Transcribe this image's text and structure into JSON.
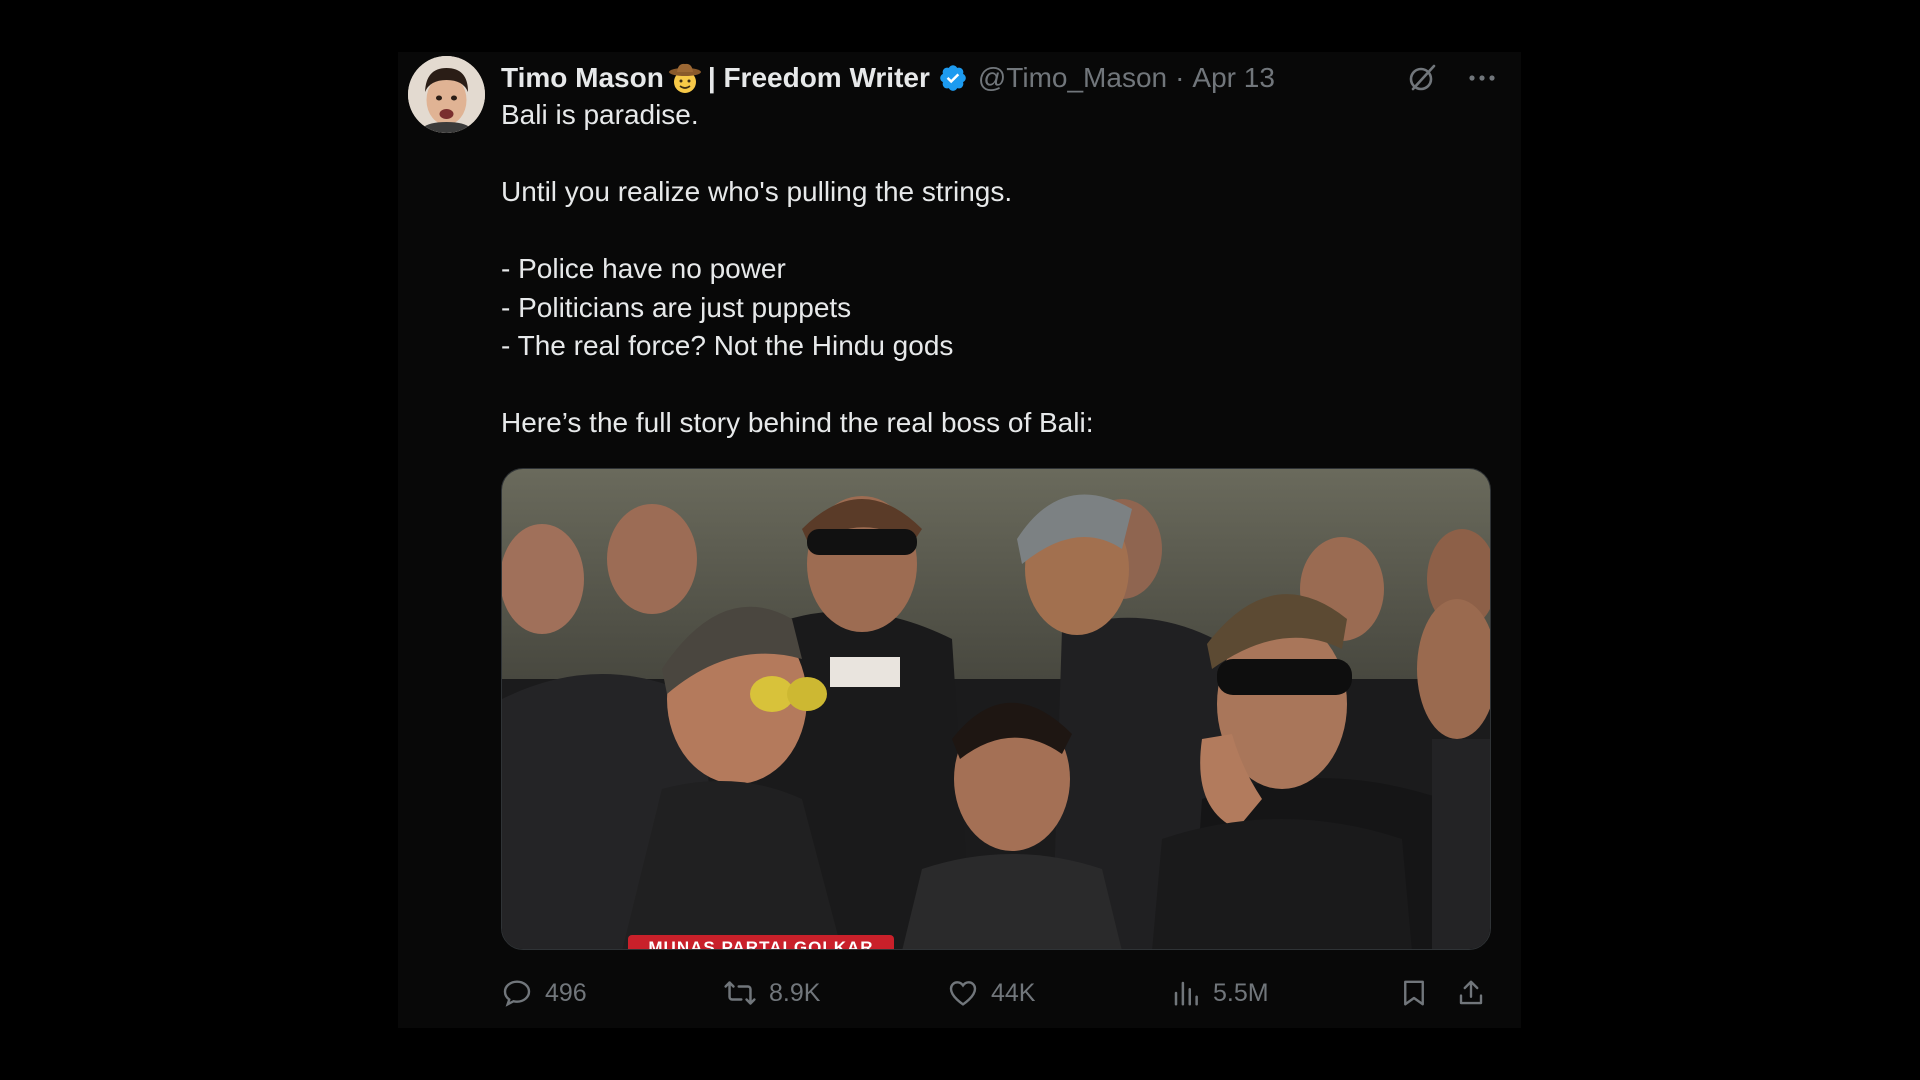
{
  "tweet": {
    "author": {
      "display_name": "Timo Mason",
      "name_emoji": "cowboy-face-emoji",
      "display_suffix": "| Freedom Writer",
      "verified": true,
      "handle": "@Timo_Mason",
      "separator": "·",
      "date": "Apr 13"
    },
    "body": {
      "line1": "Bali is paradise.",
      "line2": "Until you realize who's pulling the strings.",
      "line3": "- Police have no power",
      "line4": "- Politicians are just puppets",
      "line5": "- The real force? Not the Hindu gods",
      "line6": "Here’s the full story behind the real boss of Bali:"
    },
    "media": {
      "caption": "MUNAS PARTAI GOLKAR",
      "type": "video-still"
    },
    "metrics": {
      "replies": "496",
      "reposts": "8.9K",
      "likes": "44K",
      "views": "5.5M"
    }
  },
  "icons": {
    "grok": "grok-icon",
    "more": "more-icon",
    "reply": "reply-icon",
    "repost": "repost-icon",
    "like": "heart-icon",
    "views": "views-icon",
    "bookmark": "bookmark-icon",
    "share": "share-icon"
  },
  "colors": {
    "background": "#000000",
    "card": "#080808",
    "text": "#e7e9ea",
    "muted": "#71767b",
    "verified": "#1d9bf0",
    "caption_bar": "#c9202a"
  }
}
